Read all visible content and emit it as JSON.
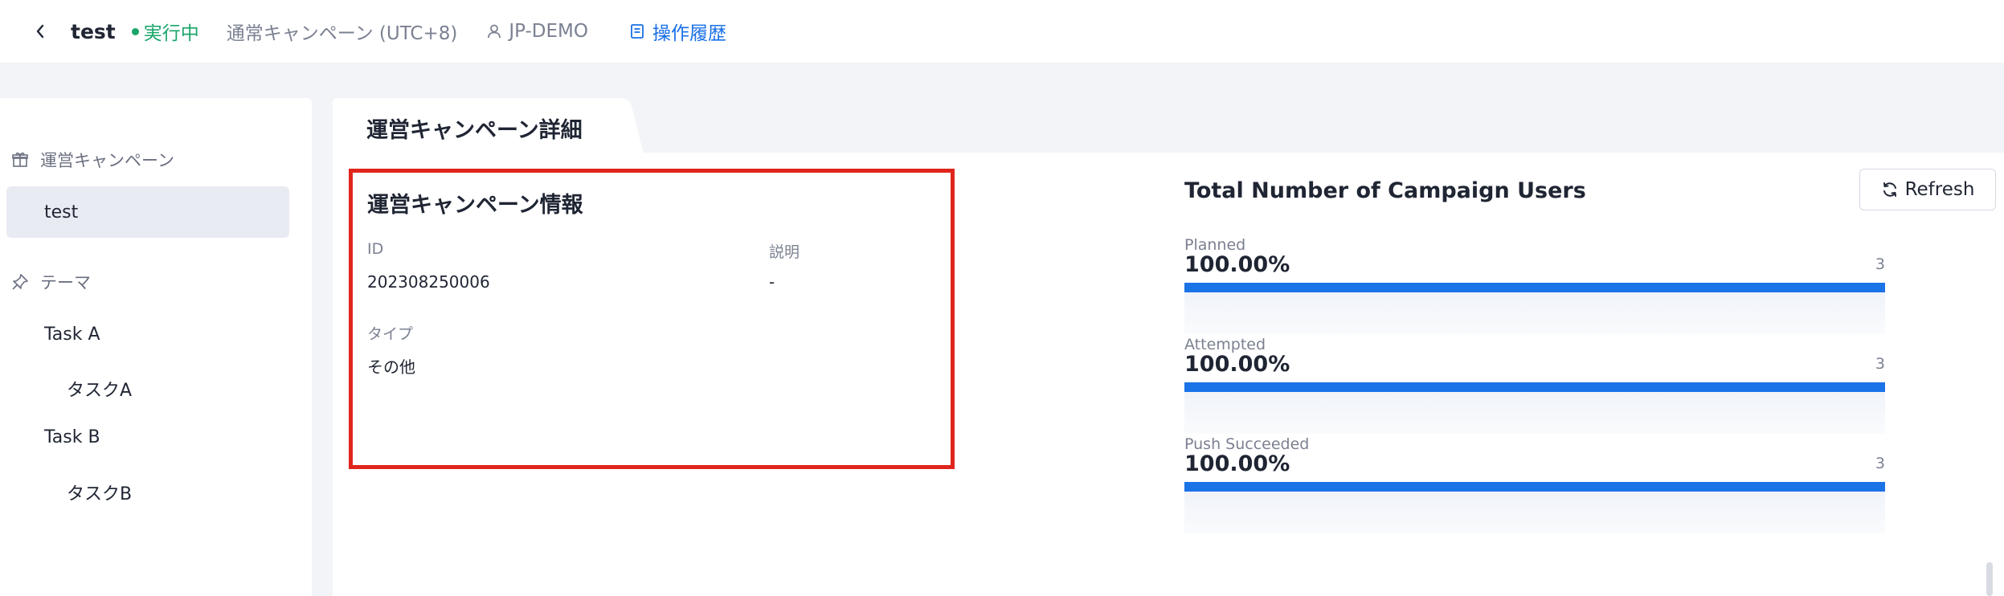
{
  "header": {
    "title": "test",
    "status": "実行中",
    "campaign_type": "通常キャンペーン (UTC+8)",
    "account": "JP-DEMO",
    "history_link": "操作履歴",
    "status_color": "#1aa56a",
    "accent_color": "#1870e6"
  },
  "sidebar": {
    "campaign_group": "運営キャンペーン",
    "campaign_item": "test",
    "theme_group": "テーマ",
    "items": [
      {
        "label": "Task A"
      },
      {
        "label": "タスクA"
      },
      {
        "label": "Task B"
      },
      {
        "label": "タスクB"
      }
    ]
  },
  "tab": {
    "label": "運営キャンペーン詳細"
  },
  "info": {
    "title": "運営キャンペーン情報",
    "id_label": "ID",
    "id_value": "202308250006",
    "desc_label": "説明",
    "desc_value": "-",
    "type_label": "タイプ",
    "type_value": "その他",
    "highlight_color": "#e0261c"
  },
  "stats": {
    "title": "Total Number of Campaign Users",
    "refresh_label": "Refresh",
    "bar_color": "#1b73e8",
    "items": [
      {
        "label": "Planned",
        "percent": "100.00%",
        "fill": 100,
        "count": "3"
      },
      {
        "label": "Attempted",
        "percent": "100.00%",
        "fill": 100,
        "count": "3"
      },
      {
        "label": "Push Succeeded",
        "percent": "100.00%",
        "fill": 100,
        "count": "3"
      }
    ]
  }
}
